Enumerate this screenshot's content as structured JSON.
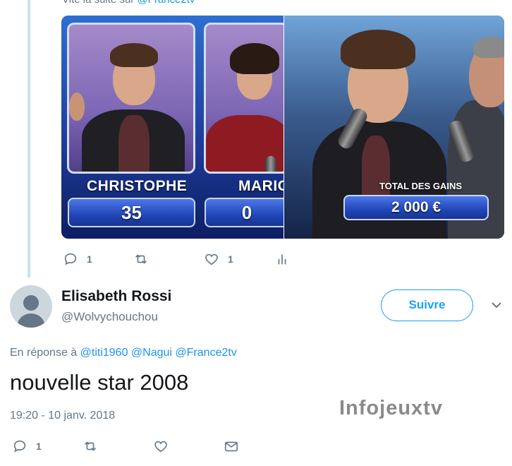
{
  "top_link": {
    "prefix": "Vite la suite sur ",
    "mention": "@France2tv"
  },
  "media": {
    "left_panel": {
      "contestant_1": {
        "name": "CHRISTOPHE",
        "score": "35"
      },
      "contestant_2": {
        "name": "MARIO",
        "score": "0"
      }
    },
    "right_panel": {
      "label": "TOTAL DES GAINS",
      "amount": "2 000 €"
    }
  },
  "prev_actions": {
    "reply_count": "1",
    "like_count": "1"
  },
  "tweet": {
    "display_name": "Elisabeth Rossi",
    "handle": "@Wolvychouchou",
    "follow_label": "Suivre",
    "reply_prefix": "En réponse à ",
    "reply_mentions": [
      "@titi1960",
      "@Nagui",
      "@France2tv"
    ],
    "text": "nouvelle star 2008",
    "timestamp": "19:20 - 10 janv. 2018",
    "reply_count": "1"
  },
  "watermark": "Infojeuxtv",
  "colors": {
    "accent": "#1da1f2",
    "mention": "#1b95e0",
    "secondary_text": "#657786",
    "thread_line": "#c4e4ed"
  }
}
